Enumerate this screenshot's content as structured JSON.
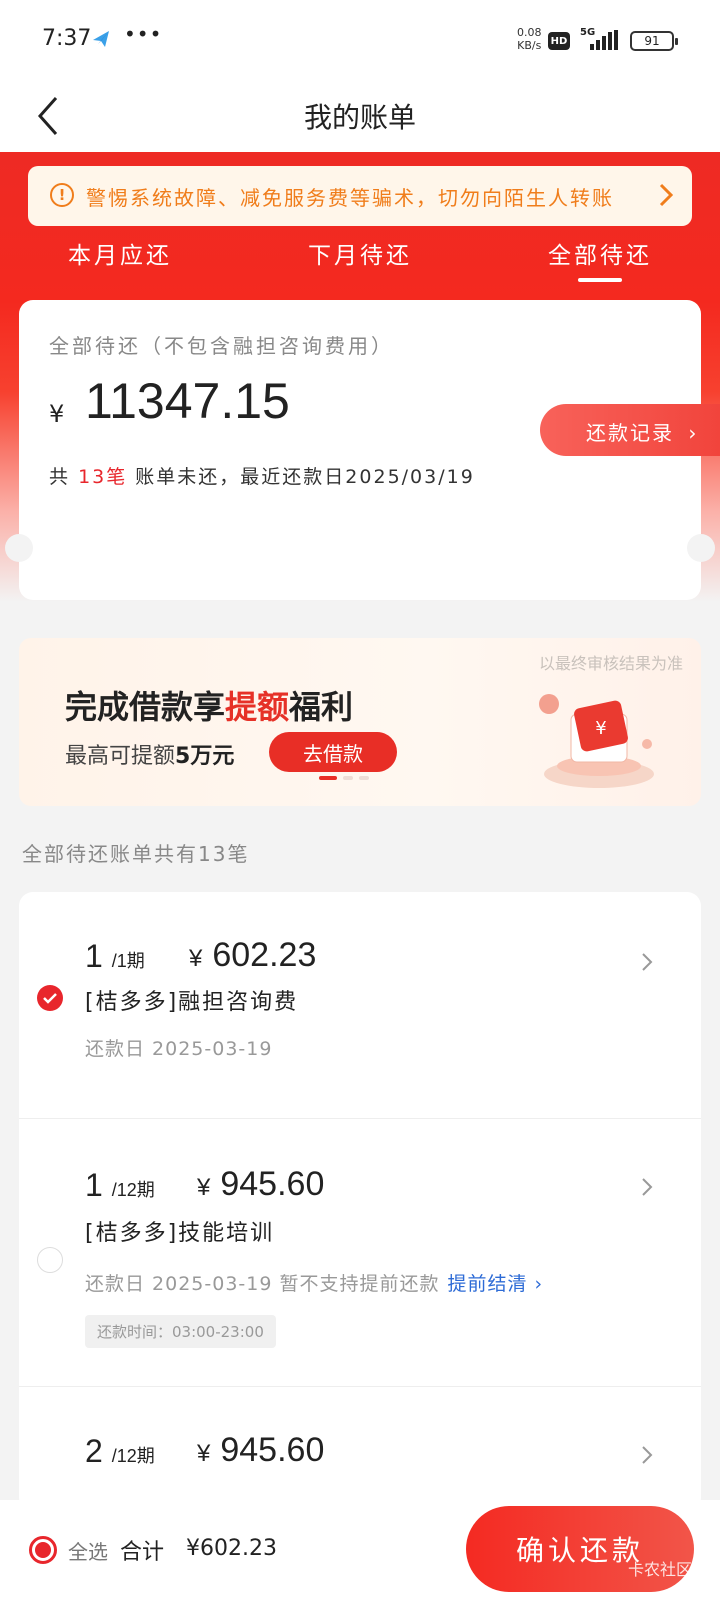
{
  "status_bar": {
    "time": "7:37",
    "more": "•••",
    "speed_value": "0.08",
    "speed_unit": "KB/s",
    "hd": "HD",
    "network": "5G",
    "battery": "91"
  },
  "nav": {
    "title": "我的账单"
  },
  "notice": {
    "text": "警惕系统故障、减免服务费等骗术，切勿向陌生人转账"
  },
  "tabs": [
    {
      "label": "本月应还"
    },
    {
      "label": "下月待还"
    },
    {
      "label": "全部待还",
      "active": true
    }
  ],
  "summary": {
    "subtitle": "全部待还（不包含融担咨询费用）",
    "currency": "¥",
    "amount": "11347.15",
    "desc_prefix": "共",
    "count": "13笔",
    "desc_suffix": "账单未还，最近还款日2025/03/19",
    "records_label": "还款记录"
  },
  "banner": {
    "note": "以最终审核结果为准",
    "headline_pre": "完成借款享",
    "headline_hl": "提额",
    "headline_post": "福利",
    "sub_pre": "最高可提额",
    "sub_bold": "5万元",
    "button": "去借款"
  },
  "list_label": "全部待还账单共有13笔",
  "items": [
    {
      "period": "1",
      "total": "/1期",
      "currency": "¥",
      "amount": "602.23",
      "name": "[桔多多]融担咨询费",
      "date": "还款日  2025-03-19",
      "checked": true
    },
    {
      "period": "1",
      "total": "/12期",
      "currency": "¥",
      "amount": "945.60",
      "name": "[桔多多]技能培训",
      "date": "还款日  2025-03-19  暂不支持提前还款",
      "early": "提前结清",
      "time": "还款时间：03:00-23:00",
      "checked": false
    },
    {
      "period": "2",
      "total": "/12期",
      "currency": "¥",
      "amount": "945.60"
    }
  ],
  "bottom": {
    "select_all": "全选",
    "total_label": "合计",
    "total_amount": "¥602.23",
    "confirm": "确认还款"
  },
  "watermark": "卡农社区",
  "colors": {
    "brand_red": "#e8262c",
    "warning_orange": "#f07d1b",
    "link_blue": "#2d6bd6"
  }
}
